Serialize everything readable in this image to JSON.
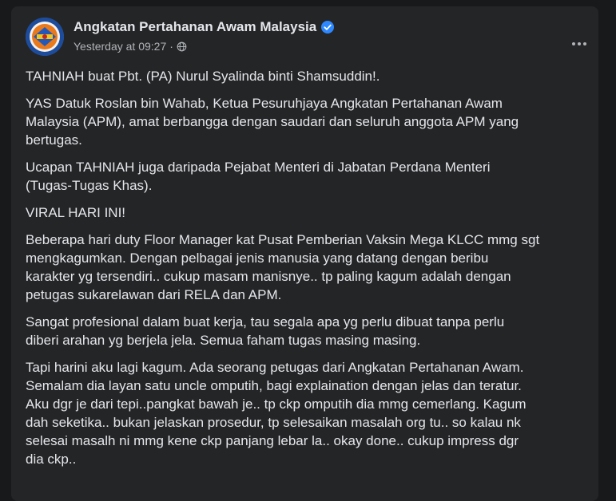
{
  "post": {
    "author": "Angkatan Pertahanan Awam Malaysia",
    "verified": true,
    "timestamp": "Yesterday at 09:27",
    "separator": "·",
    "audience_icon": "globe-icon",
    "menu_icon": "more-options-icon",
    "paragraphs": [
      "TAHNIAH buat Pbt. (PA) Nurul Syalinda binti Shamsuddin!.",
      "YAS Datuk Roslan bin Wahab, Ketua Pesuruhjaya Angkatan Pertahanan Awam\nMalaysia (APM), amat berbangga dengan saudari dan seluruh anggota APM yang\nbertugas.",
      "Ucapan TAHNIAH juga daripada Pejabat Menteri di Jabatan Perdana Menteri\n(Tugas-Tugas Khas).",
      "VIRAL HARI INI!",
      "Beberapa hari duty Floor Manager kat Pusat Pemberian Vaksin Mega KLCC mmg sgt\nmengkagumkan. Dengan pelbagai jenis manusia yang datang dengan beribu\nkarakter yg tersendiri.. cukup masam manisnye.. tp paling kagum adalah dengan\npetugas sukarelawan dari RELA dan APM.",
      "Sangat profesional dalam buat kerja, tau segala apa yg perlu dibuat tanpa perlu\ndiberi arahan yg berjela jela. Semua faham tugas masing masing.",
      "Tapi harini aku lagi kagum. Ada seorang petugas dari Angkatan Pertahanan Awam.\nSemalam dia layan satu uncle omputih, bagi explaination dengan jelas dan teratur.\nAku dgr je dari tepi..pangkat bawah je.. tp ckp omputih dia mmg cemerlang. Kagum\ndah seketika.. bukan jelaskan prosedur, tp selesaikan masalah org tu.. so kalau nk\nselesai masalh ni mmg kene ckp panjang lebar la.. okay done.. cukup impress dgr\ndia ckp.."
    ]
  },
  "colors": {
    "background": "#18191a",
    "card": "#242526",
    "text_primary": "#e4e6eb",
    "text_secondary": "#b0b3b8",
    "verified_badge": "#2d88ff"
  }
}
